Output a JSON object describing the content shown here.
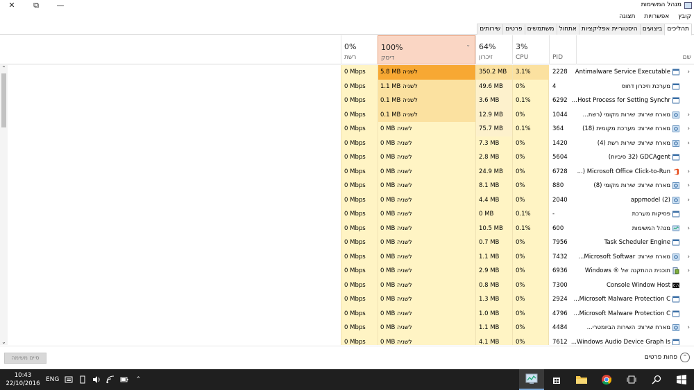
{
  "window": {
    "title": "מנהל המשימות",
    "close_glyph": "✕",
    "maximize_glyph": "⧉",
    "minimize_glyph": "—"
  },
  "menu": [
    "קובץ",
    "אפשרויות",
    "תצוגה"
  ],
  "tabs": [
    {
      "label": "תהליכים",
      "active": true
    },
    {
      "label": "ביצועים",
      "active": false
    },
    {
      "label": "היסטוריית אפליקציות",
      "active": false
    },
    {
      "label": "אתחול",
      "active": false
    },
    {
      "label": "משתמשים",
      "active": false
    },
    {
      "label": "פרטים",
      "active": false
    },
    {
      "label": "שירותים",
      "active": false
    }
  ],
  "columns": {
    "name": "שם",
    "pid": "PID",
    "cpu_pct": "3%",
    "cpu": "CPU",
    "mem_pct": "64%",
    "mem": "זיכרון",
    "disk_pct": "100%",
    "disk": "דיסק",
    "net_pct": "0%",
    "net": "רשת",
    "sort_glyph": "⌄"
  },
  "processes": [
    {
      "name": "Antimalware Service Executable",
      "pid": "2228",
      "cpu": "3.1%",
      "mem": "350.2 MB",
      "disk": "5.8 MB לשניה",
      "net": "0 Mbps",
      "icon": "app-window-icon",
      "expandable": true
    },
    {
      "name": "מערכת וזיכרון דחוס",
      "pid": "4",
      "cpu": "0%",
      "mem": "49.6 MB",
      "disk": "1.1 MB לשניה",
      "net": "0 Mbps",
      "icon": "app-window-icon",
      "expandable": false
    },
    {
      "name": "Host Process for Setting Synchr...",
      "pid": "6292",
      "cpu": "0.1%",
      "mem": "3.6 MB",
      "disk": "0.1 MB לשניה",
      "net": "0 Mbps",
      "icon": "app-window-icon",
      "expandable": false
    },
    {
      "name": "מארח שירות: שירות מקומי (רשת...",
      "pid": "1044",
      "cpu": "0%",
      "mem": "12.9 MB",
      "disk": "0.1 MB לשניה",
      "net": "0 Mbps",
      "icon": "gear-icon",
      "expandable": true
    },
    {
      "name": "מארח שירות: מערכת מקומית (18)",
      "pid": "364",
      "cpu": "0.1%",
      "mem": "75.7 MB",
      "disk": "0 MB לשניה",
      "net": "0 Mbps",
      "icon": "gear-icon",
      "expandable": true
    },
    {
      "name": "מארח שירות: שירות רשת (4)",
      "pid": "1420",
      "cpu": "0%",
      "mem": "7.3 MB",
      "disk": "0 MB לשניה",
      "net": "0 Mbps",
      "icon": "gear-icon",
      "expandable": true
    },
    {
      "name": "GDCAgent (32 סיביות)",
      "pid": "5604",
      "cpu": "0%",
      "mem": "2.8 MB",
      "disk": "0 MB לשניה",
      "net": "0 Mbps",
      "icon": "app-window-icon",
      "expandable": false
    },
    {
      "name": "Microsoft Office Click-to-Run (...",
      "pid": "6728",
      "cpu": "0%",
      "mem": "24.9 MB",
      "disk": "0 MB לשניה",
      "net": "0 Mbps",
      "icon": "office-icon",
      "expandable": true
    },
    {
      "name": "מארח שירות: שירות מקומי (8)",
      "pid": "880",
      "cpu": "0%",
      "mem": "8.1 MB",
      "disk": "0 MB לשניה",
      "net": "0 Mbps",
      "icon": "gear-icon",
      "expandable": true
    },
    {
      "name": "appmodel (2)",
      "pid": "2040",
      "cpu": "0%",
      "mem": "4.4 MB",
      "disk": "0 MB לשניה",
      "net": "0 Mbps",
      "icon": "gear-icon",
      "expandable": true
    },
    {
      "name": "פסיקות מערכת",
      "pid": "-",
      "cpu": "0.1%",
      "mem": "0 MB",
      "disk": "0 MB לשניה",
      "net": "0 Mbps",
      "icon": "app-window-icon",
      "expandable": false
    },
    {
      "name": "מנהל המשימות",
      "pid": "600",
      "cpu": "0.1%",
      "mem": "10.5 MB",
      "disk": "0 MB לשניה",
      "net": "0 Mbps",
      "icon": "task-manager-icon",
      "expandable": true
    },
    {
      "name": "Task Scheduler Engine",
      "pid": "7956",
      "cpu": "0%",
      "mem": "0.7 MB",
      "disk": "0 MB לשניה",
      "net": "0 Mbps",
      "icon": "app-window-icon",
      "expandable": false
    },
    {
      "name": "מארח שירות: Microsoft Softwar...",
      "pid": "7432",
      "cpu": "0%",
      "mem": "1.1 MB",
      "disk": "0 MB לשניה",
      "net": "0 Mbps",
      "icon": "gear-icon",
      "expandable": true
    },
    {
      "name": "תוכנית ההתקנה של ® Windows",
      "pid": "6936",
      "cpu": "0%",
      "mem": "2.9 MB",
      "disk": "0 MB לשניה",
      "net": "0 Mbps",
      "icon": "installer-icon",
      "expandable": true
    },
    {
      "name": "Console Window Host",
      "pid": "7300",
      "cpu": "0%",
      "mem": "0.8 MB",
      "disk": "0 MB לשניה",
      "net": "0 Mbps",
      "icon": "console-icon",
      "expandable": false
    },
    {
      "name": "Microsoft Malware Protection C...",
      "pid": "2924",
      "cpu": "0%",
      "mem": "1.3 MB",
      "disk": "0 MB לשניה",
      "net": "0 Mbps",
      "icon": "app-window-icon",
      "expandable": false
    },
    {
      "name": "Microsoft Malware Protection C...",
      "pid": "4796",
      "cpu": "0%",
      "mem": "1.0 MB",
      "disk": "0 MB לשניה",
      "net": "0 Mbps",
      "icon": "app-window-icon",
      "expandable": false
    },
    {
      "name": "מארח שירות: השירות הביומטרי...",
      "pid": "4484",
      "cpu": "0%",
      "mem": "1.1 MB",
      "disk": "0 MB לשניה",
      "net": "0 Mbps",
      "icon": "gear-icon",
      "expandable": true
    },
    {
      "name": "Windows Audio Device Graph Is...",
      "pid": "7612",
      "cpu": "0%",
      "mem": "4.1 MB",
      "disk": "0 MB לשניה",
      "net": "0 Mbps",
      "icon": "app-window-icon",
      "expandable": false
    }
  ],
  "footer": {
    "end_task": "סיים משימה",
    "fewer_details": "פחות פרטים",
    "fewer_glyph": "⌃"
  },
  "taskbar": {
    "time": "10:43",
    "date": "22/10/2016",
    "language": "ENG",
    "tray_up_glyph": "⌃"
  },
  "colors": {
    "heat_high": "#f7a833",
    "heat_mid": "#fbe1a0",
    "heat_low": "#fdf1cc",
    "heat_base": "#fff4c4",
    "selected_header": "#fad6c4",
    "taskbar": "#1f1f1f"
  }
}
